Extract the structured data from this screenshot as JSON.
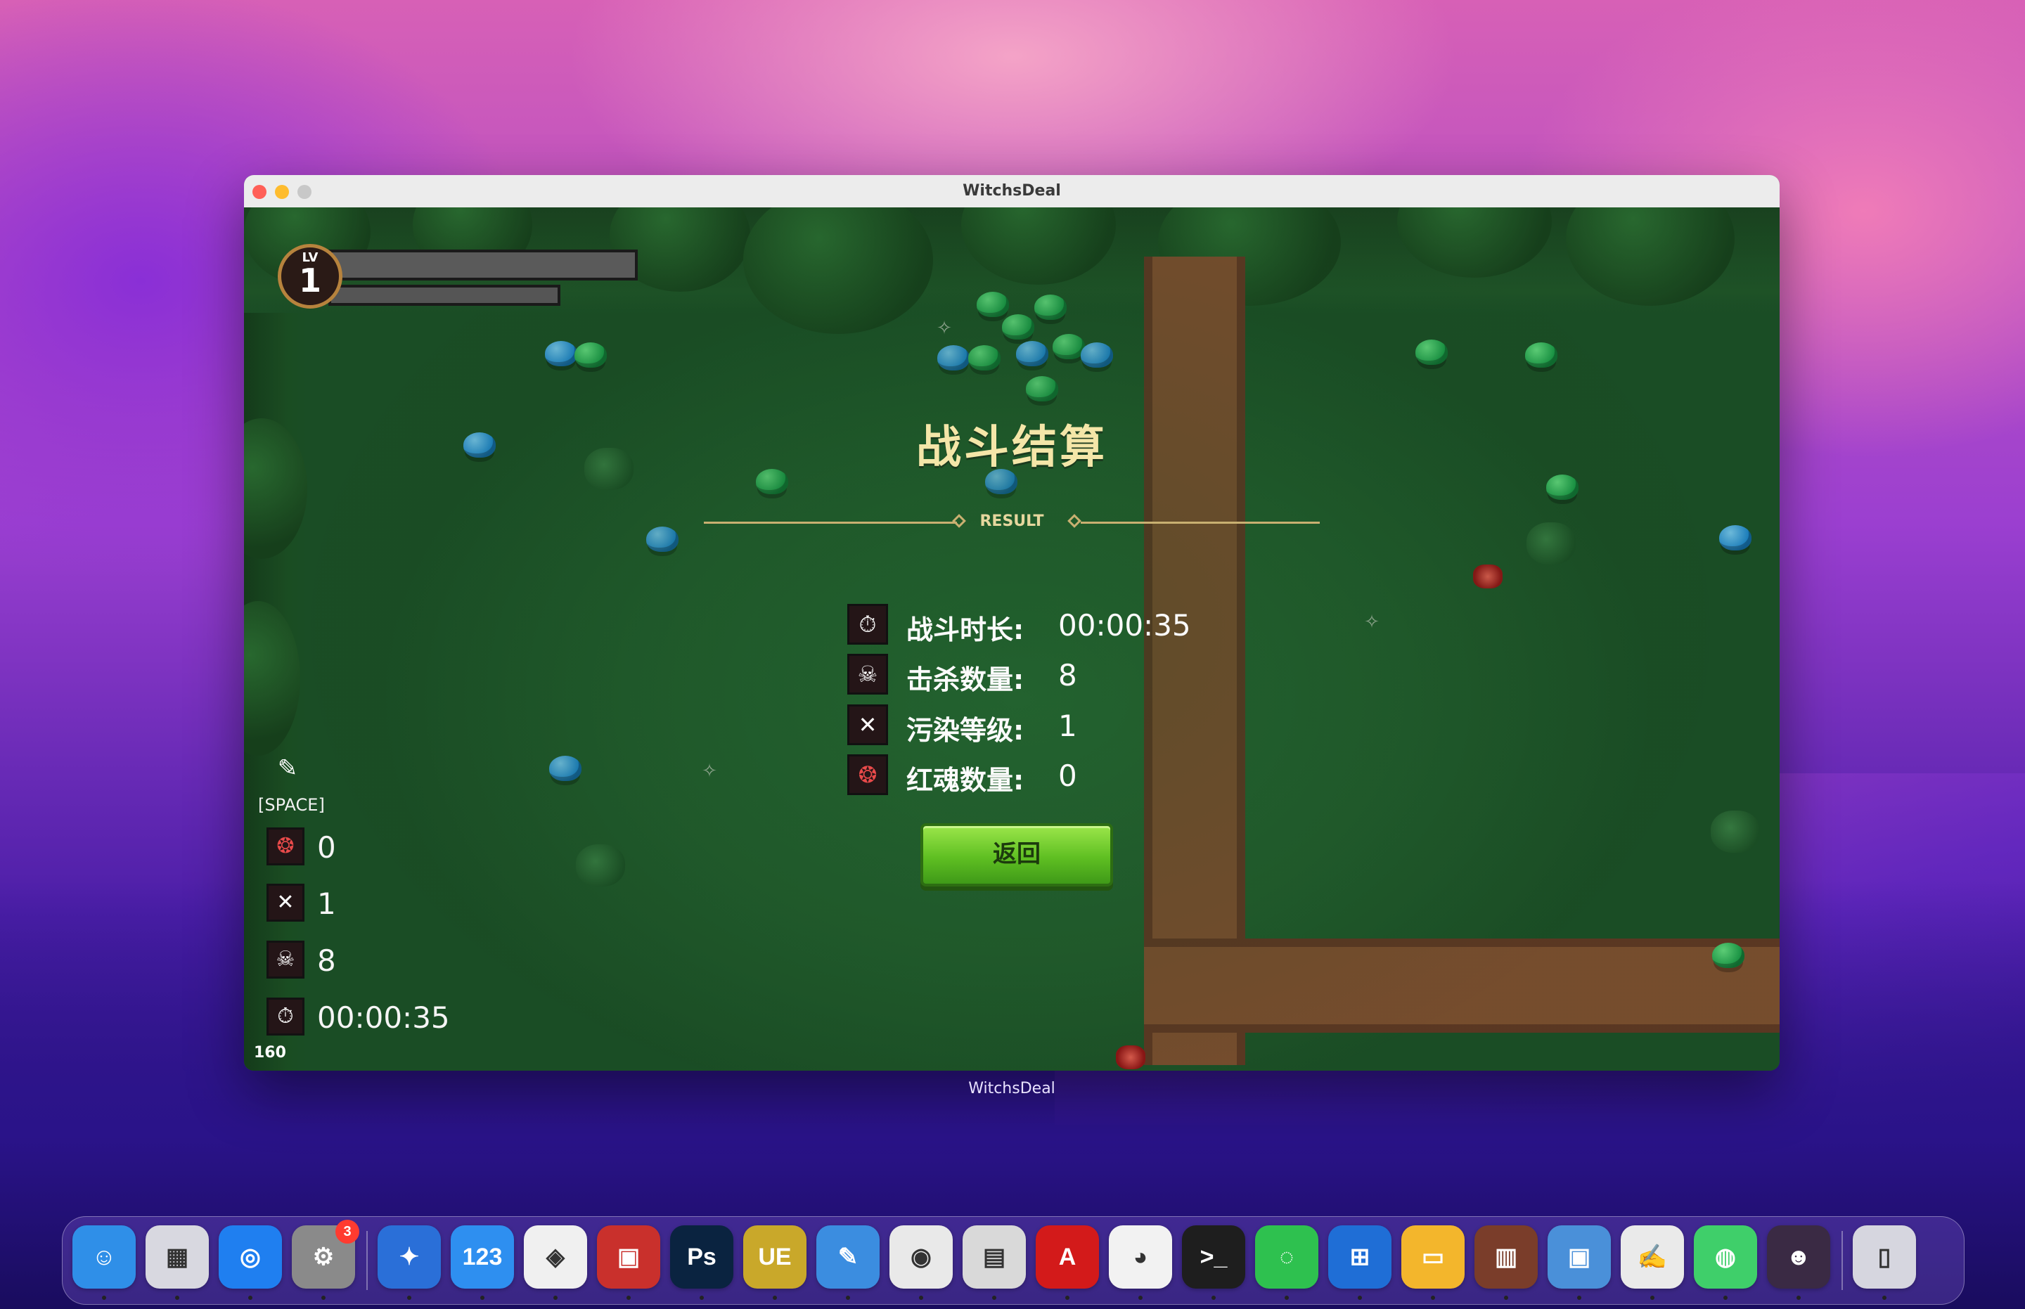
{
  "window": {
    "title": "WitchsDeal",
    "caption": "WitchsDeal"
  },
  "hud": {
    "level_label": "LV",
    "level_value": "1",
    "skill_key": "[SPACE]",
    "red_souls": "0",
    "pollution": "1",
    "kills": "8",
    "time": "00:00:35",
    "fps": "160"
  },
  "result": {
    "title": "战斗结算",
    "subtitle": "RESULT",
    "stats": [
      {
        "icon": "stopwatch-icon",
        "label": "战斗时长:",
        "value": "00:00:35"
      },
      {
        "icon": "skull-icon",
        "label": "击杀数量:",
        "value": "8"
      },
      {
        "icon": "crossed-swords-icon",
        "label": "污染等级:",
        "value": "1"
      },
      {
        "icon": "red-soul-icon",
        "label": "红魂数量:",
        "value": "0"
      }
    ],
    "back_label": "返回"
  },
  "dock": {
    "items": [
      {
        "name": "finder",
        "glyph": "☺",
        "color": "#2f8fe8"
      },
      {
        "name": "launchpad",
        "glyph": "▦",
        "color": "#d8d8e0"
      },
      {
        "name": "safari",
        "glyph": "◎",
        "color": "#1f7ff0"
      },
      {
        "name": "system-preferences",
        "glyph": "⚙",
        "color": "#8a8a8a",
        "badge": "3"
      },
      {
        "name": "app-5",
        "glyph": "✦",
        "color": "#2a6fd8"
      },
      {
        "name": "numbers",
        "glyph": "123",
        "color": "#2e8ff0"
      },
      {
        "name": "baidu-netdisk",
        "glyph": "◈",
        "color": "#f0f0f0"
      },
      {
        "name": "parallels",
        "glyph": "▣",
        "color": "#c9302c"
      },
      {
        "name": "photoshop",
        "glyph": "Ps",
        "color": "#0a2340"
      },
      {
        "name": "unreal-engine",
        "glyph": "UE",
        "color": "#c9a82a"
      },
      {
        "name": "xcode",
        "glyph": "✎",
        "color": "#3b8de0"
      },
      {
        "name": "chrome",
        "glyph": "◉",
        "color": "#e9e9e9"
      },
      {
        "name": "printer",
        "glyph": "▤",
        "color": "#d9d9d9"
      },
      {
        "name": "acrobat",
        "glyph": "A",
        "color": "#d31a1a"
      },
      {
        "name": "qq",
        "glyph": "◕",
        "color": "#f2f2f2"
      },
      {
        "name": "terminal",
        "glyph": ">_",
        "color": "#1e1e1e"
      },
      {
        "name": "wechat",
        "glyph": "◌",
        "color": "#2ec14f"
      },
      {
        "name": "windows",
        "glyph": "⊞",
        "color": "#1f6ed6"
      },
      {
        "name": "folder",
        "glyph": "▭",
        "color": "#f3b62c"
      },
      {
        "name": "winrar",
        "glyph": "▥",
        "color": "#7a3d2a"
      },
      {
        "name": "remote-desktop",
        "glyph": "▣",
        "color": "#4a90d9"
      },
      {
        "name": "textedit",
        "glyph": "✍",
        "color": "#eaeaea"
      },
      {
        "name": "app-23",
        "glyph": "◍",
        "color": "#3fcf6a"
      },
      {
        "name": "avatar-app",
        "glyph": "☻",
        "color": "#3a2a44"
      },
      {
        "name": "trash",
        "glyph": "▯",
        "color": "#d6d6df"
      }
    ]
  }
}
